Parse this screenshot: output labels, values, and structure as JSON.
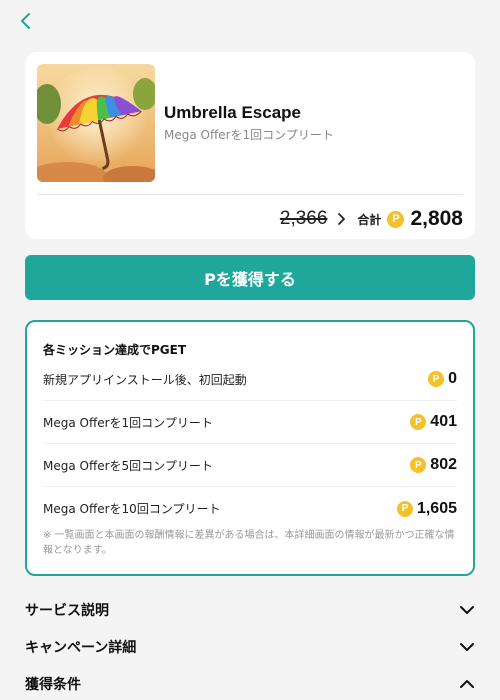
{
  "nav": {
    "back_icon": "chevron-left-icon",
    "accent": "#1fa89a"
  },
  "offer": {
    "app_name": "Umbrella Escape",
    "subtitle": "Mega Offerを1回コンプリート",
    "old_price": "2,366",
    "total_label": "合計",
    "coin_symbol": "P",
    "total": "2,808"
  },
  "cta": {
    "label": "Pを獲得する",
    "color": "#1fa89a"
  },
  "missions": {
    "title": "各ミッション達成でPGET",
    "coin_symbol": "P",
    "items": [
      {
        "label": "新規アプリインストール後、初回起動",
        "points": "0"
      },
      {
        "label": "Mega Offerを1回コンプリート",
        "points": "401"
      },
      {
        "label": "Mega Offerを5回コンプリート",
        "points": "802"
      },
      {
        "label": "Mega Offerを10回コンプリート",
        "points": "1,605"
      }
    ],
    "note": "※ 一覧画面と本画面の報酬情報に差異がある場合は、本詳細画面の情報が最新かつ正確な情報となります。"
  },
  "sections": [
    {
      "label": "サービス説明",
      "state": "collapsed"
    },
    {
      "label": "キャンペーン詳細",
      "state": "collapsed"
    },
    {
      "label": "獲得条件",
      "state": "expanded"
    }
  ]
}
